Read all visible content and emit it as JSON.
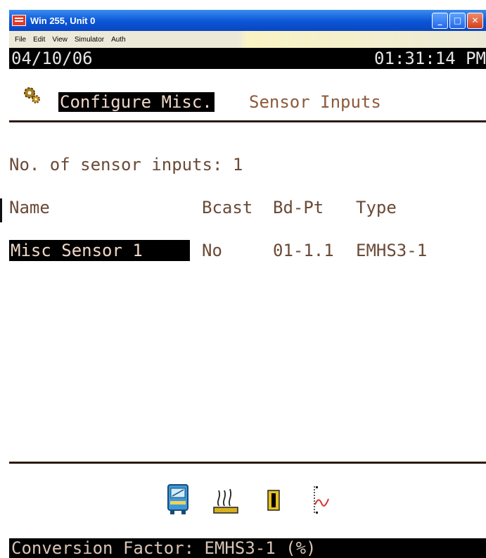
{
  "window": {
    "title": "Win 255, Unit 0",
    "buttons": {
      "minimize": "_",
      "maximize": "□",
      "close": "✕"
    }
  },
  "menu": {
    "items": [
      "File",
      "Edit",
      "View",
      "Simulator",
      "Auth"
    ]
  },
  "status": {
    "date": "04/10/06",
    "time": "01:31:14 PM"
  },
  "header": {
    "icon": "gear-icon",
    "selected": "Configure Misc.",
    "rest": "Sensor Inputs"
  },
  "summary": "No. of sensor inputs: 1",
  "table": {
    "columns": [
      "Name",
      "Bcast",
      "Bd-Pt",
      "Type"
    ],
    "rows": [
      {
        "name": "Misc Sensor 1",
        "bcast": "No",
        "bdpt": "01-1.1",
        "type": "EMHS3-1"
      }
    ]
  },
  "toolbar": {
    "icons": [
      "bus-icon",
      "sensor-input-icon",
      "output-device-icon",
      "signal-graph-icon"
    ]
  },
  "footer": "Conversion Factor: EMHS3-1 (%)"
}
